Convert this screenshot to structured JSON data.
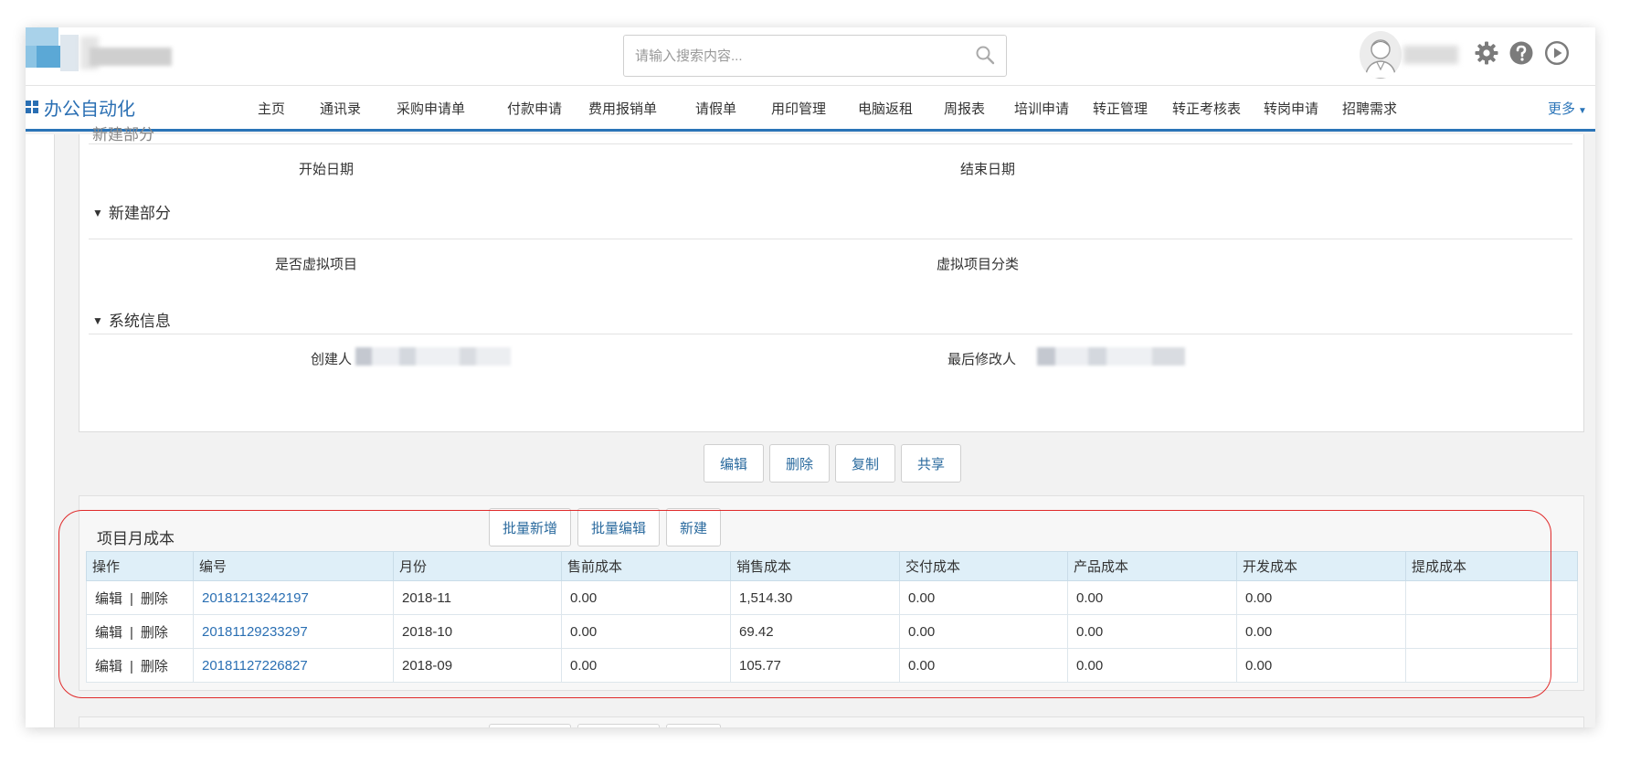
{
  "search": {
    "placeholder": "请输入搜索内容..."
  },
  "brand": {
    "name": "办公自动化"
  },
  "nav": {
    "items": [
      "主页",
      "通讯录",
      "采购申请单",
      "付款申请",
      "费用报销单",
      "请假单",
      "用印管理",
      "电脑返租",
      "周报表",
      "培训申请",
      "转正管理",
      "转正考核表",
      "转岗申请",
      "招聘需求"
    ],
    "more_label": "更多"
  },
  "detail": {
    "clipped_section": "新建部分",
    "fields_row1": {
      "left": "开始日期",
      "right": "结束日期"
    },
    "section2": "新建部分",
    "fields_row2": {
      "left": "是否虚拟项目",
      "right": "虚拟项目分类"
    },
    "section3": "系统信息",
    "fields_row3": {
      "left": "创建人",
      "right": "最后修改人"
    }
  },
  "actions": {
    "edit": "编辑",
    "delete": "删除",
    "copy": "复制",
    "share": "共享"
  },
  "cost_panel": {
    "title": "项目月成本",
    "batch_add": "批量新增",
    "batch_edit": "批量编辑",
    "new": "新建",
    "columns": [
      "操作",
      "编号",
      "月份",
      "售前成本",
      "销售成本",
      "交付成本",
      "产品成本",
      "开发成本",
      "提成成本"
    ],
    "row_edit": "编辑",
    "row_delete": "删除",
    "rows": [
      {
        "id": "20181213242197",
        "month": "2018-11",
        "presale": "0.00",
        "sales": "1,514.30",
        "delivery": "0.00",
        "product": "0.00",
        "dev": "0.00",
        "commission": ""
      },
      {
        "id": "20181129233297",
        "month": "2018-10",
        "presale": "0.00",
        "sales": "69.42",
        "delivery": "0.00",
        "product": "0.00",
        "dev": "0.00",
        "commission": ""
      },
      {
        "id": "20181127226827",
        "month": "2018-09",
        "presale": "0.00",
        "sales": "105.77",
        "delivery": "0.00",
        "product": "0.00",
        "dev": "0.00",
        "commission": ""
      }
    ]
  },
  "colors": {
    "accent": "#2a74b8",
    "link": "#2a6fb3",
    "highlight_outline": "#e02a2a",
    "table_header": "#dfeff8"
  },
  "icons": {
    "search": "search-icon",
    "settings": "gear-icon",
    "help": "help-icon",
    "play": "play-circle-icon",
    "avatar": "user-avatar-icon"
  }
}
